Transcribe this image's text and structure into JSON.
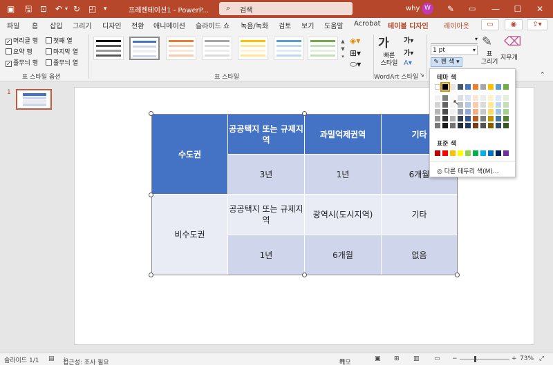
{
  "titlebar": {
    "document_title": "프레젠테이션1 - PowerP...",
    "search_placeholder": "검색",
    "user_name": "why",
    "avatar_letter": "W"
  },
  "tabs": [
    "파일",
    "홈",
    "삽입",
    "그리기",
    "디자인",
    "전환",
    "애니메이션",
    "슬라이드 쇼",
    "녹음/녹화",
    "검토",
    "보기",
    "도움말",
    "Acrobat",
    "테이블 디자인",
    "레이아웃"
  ],
  "active_tab": "테이블 디자인",
  "ribbon": {
    "style_options": {
      "header_row": "머리글 행",
      "first_column": "첫째 열",
      "total_row": "요약 행",
      "last_column": "마지막 열",
      "banded_rows": "줄무늬 행",
      "banded_columns": "줄무늬 열",
      "group_label": "표 스타일 옵션"
    },
    "styles_group_label": "표 스타일",
    "wordart_group_label": "WordArt 스타일",
    "quick_styles_label": "빠른\n스타일",
    "pen_weight": "1 pt",
    "pen_color_label": "펜 색",
    "draw_table_label": "표\n그리기",
    "eraser_label": "지우개"
  },
  "pen_color_menu": {
    "theme_colors_label": "테마 색",
    "standard_colors_label": "표준 색",
    "more_colors_label": "다른 테두리 색(M)...",
    "theme_top_row": [
      "#ffffff",
      "#000000",
      "#e7e6e6",
      "#44546a",
      "#4472c4",
      "#ed7d31",
      "#a5a5a5",
      "#ffc000",
      "#5b9bd5",
      "#70ad47"
    ],
    "standard_colors": [
      "#c00000",
      "#ff0000",
      "#ffc000",
      "#ffff00",
      "#92d050",
      "#00b050",
      "#00b0f0",
      "#0070c0",
      "#002060",
      "#7030a0"
    ]
  },
  "table": {
    "header": {
      "region": "수도권",
      "col1": "공공택지 또는 규제지역",
      "col2": "과밀억제권역",
      "col3": "기타"
    },
    "row1": {
      "col1": "3년",
      "col2": "1년",
      "col3": "6개월"
    },
    "region2": "비수도권",
    "row2": {
      "col1": "공공택지 또는 규제지역",
      "col2": "광역시(도시지역)",
      "col3": "기타"
    },
    "row3": {
      "col1": "1년",
      "col2": "6개월",
      "col3": "없음"
    }
  },
  "slide_panel": {
    "slide_number": "1"
  },
  "status": {
    "slide_info": "슬라이드 1/1",
    "accessibility": "접근성: 조사 필요",
    "notes_label": "메모",
    "zoom": "73%"
  }
}
